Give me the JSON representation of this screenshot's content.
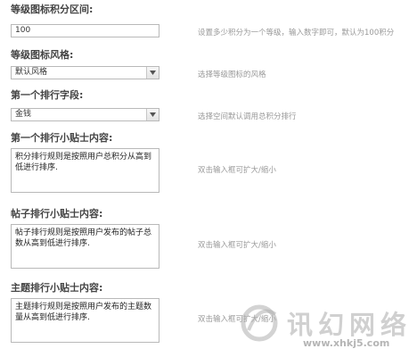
{
  "fields": [
    {
      "label": "等级图标积分区间:",
      "value": "100",
      "hint": "设置多少积分为一个等级，输入数字即可，默认为100积分"
    },
    {
      "label": "等级图标风格:",
      "value": "默认风格",
      "hint": "选择等级图标的风格"
    },
    {
      "label": "第一个排行字段:",
      "value": "金钱",
      "hint": "选择空间默认调用总积分排行"
    },
    {
      "label": "第一个排行小贴士内容:",
      "value": "积分排行规则是按照用户总积分从高到低进行排序.",
      "hint": "双击输入框可扩大/缩小"
    },
    {
      "label": "帖子排行小贴士内容:",
      "value": "帖子排行规则是按照用户发布的帖子总数从高到低进行排序.",
      "hint": "双击输入框可扩大/缩小"
    },
    {
      "label": "主题排行小贴士内容:",
      "value": "主题排行规则是按照用户发布的主题数量从高到低进行排序.",
      "hint": "双击输入框可扩大/缩小"
    }
  ],
  "watermark": {
    "text": "讯幻网络",
    "url": "www.xhkj5.com"
  },
  "colors": {
    "border": "#b9b9b9",
    "hint": "#999999",
    "label": "#444444"
  }
}
